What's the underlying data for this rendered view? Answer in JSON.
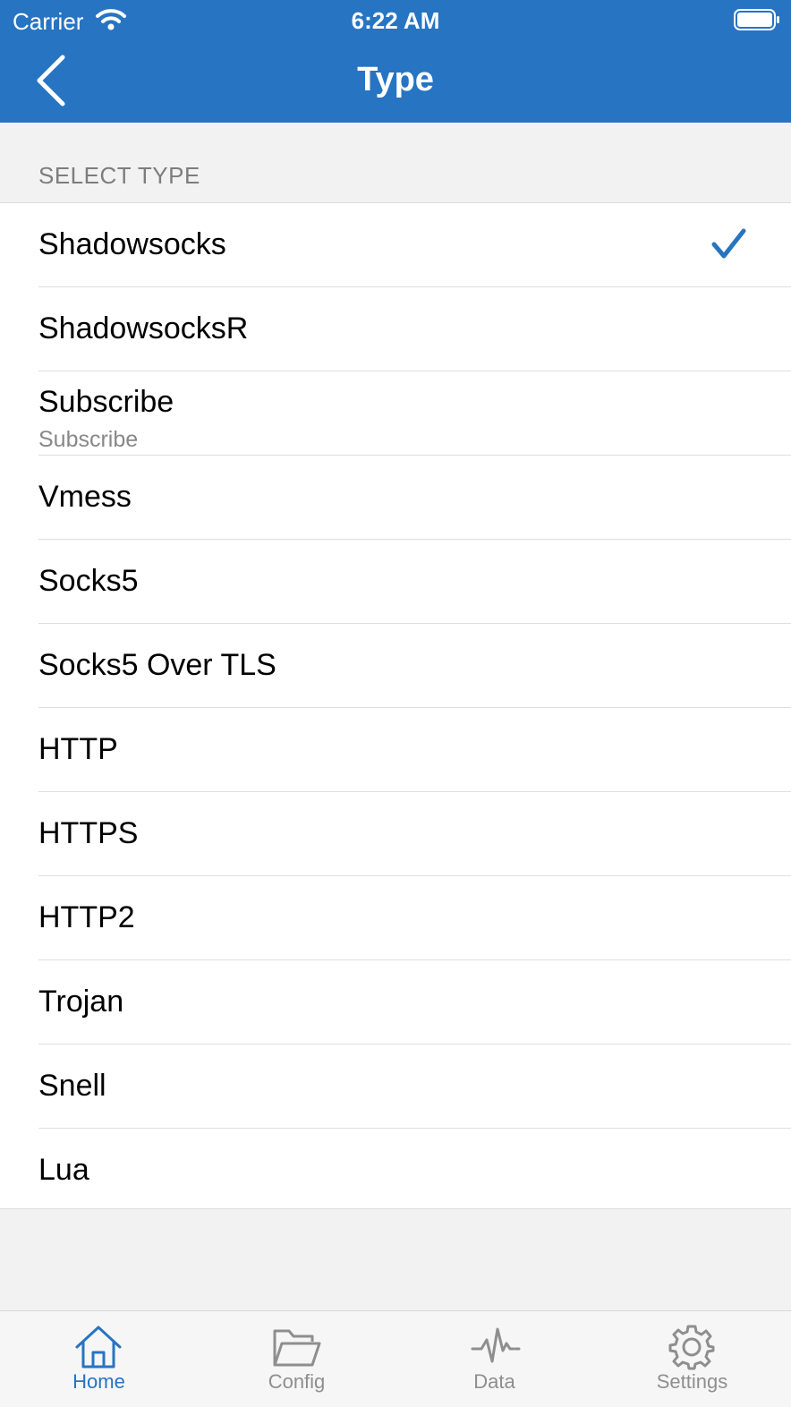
{
  "status_bar": {
    "carrier": "Carrier",
    "time": "6:22 AM"
  },
  "nav": {
    "title": "Type"
  },
  "section": {
    "header": "SELECT TYPE"
  },
  "types": [
    {
      "label": "Shadowsocks",
      "selected": true
    },
    {
      "label": "ShadowsocksR"
    },
    {
      "label": "Subscribe",
      "subtitle": "Subscribe"
    },
    {
      "label": "Vmess"
    },
    {
      "label": "Socks5"
    },
    {
      "label": "Socks5 Over TLS"
    },
    {
      "label": "HTTP"
    },
    {
      "label": "HTTPS"
    },
    {
      "label": "HTTP2"
    },
    {
      "label": "Trojan"
    },
    {
      "label": "Snell"
    },
    {
      "label": "Lua"
    }
  ],
  "tabs": [
    {
      "label": "Home",
      "icon": "home-icon",
      "active": true
    },
    {
      "label": "Config",
      "icon": "folder-icon"
    },
    {
      "label": "Data",
      "icon": "activity-icon"
    },
    {
      "label": "Settings",
      "icon": "gear-icon"
    }
  ],
  "colors": {
    "accent": "#2774c2",
    "background": "#f2f2f2",
    "inactive_tab": "#8e8e8e"
  }
}
